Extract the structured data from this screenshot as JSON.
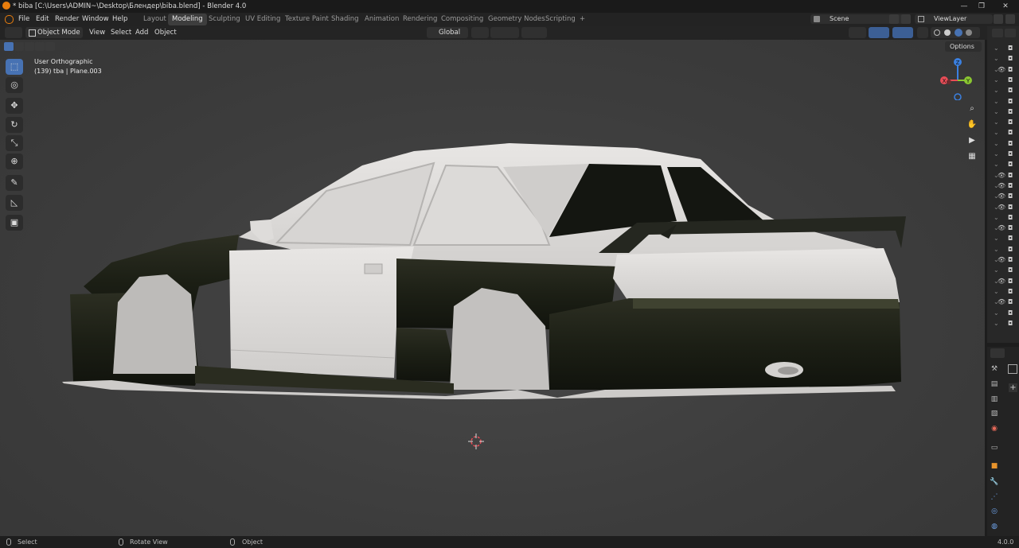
{
  "window": {
    "title": "* biba [C:\\Users\\ADMIN~\\Desktop\\Блендер\\biba.blend] - Blender 4.0",
    "controls": [
      "—",
      "❐",
      "✕"
    ]
  },
  "menu": [
    "File",
    "Edit",
    "Render",
    "Window",
    "Help"
  ],
  "workspaces": [
    "Layout",
    "Modeling",
    "Sculpting",
    "UV Editing",
    "Texture Paint",
    "Shading",
    "Animation",
    "Rendering",
    "Compositing",
    "Geometry Nodes",
    "Scripting",
    "+"
  ],
  "active_workspace": "Modeling",
  "scene": {
    "name": "Scene"
  },
  "view_layer": {
    "name": "ViewLayer"
  },
  "header": {
    "mode": "Object Mode",
    "menus": [
      "View",
      "Select",
      "Add",
      "Object"
    ],
    "orientation": "Global",
    "options": "Options"
  },
  "viewport": {
    "view_name": "User Orthographic",
    "object_info": "(139) tba | Plane.003",
    "gizmo_axes": {
      "x": "X",
      "y": "Y",
      "z": "Z"
    }
  },
  "toolbar": {
    "tools": [
      "select-box",
      "cursor",
      "move",
      "rotate",
      "scale",
      "transform",
      "annotate",
      "measure",
      "add-cube"
    ],
    "active_tool": "select-box"
  },
  "outliner": {
    "row_count": 27,
    "visible_rows": [
      false,
      false,
      true,
      false,
      false,
      false,
      false,
      false,
      false,
      false,
      false,
      false,
      true,
      true,
      true,
      true,
      false,
      true,
      false,
      false,
      true,
      false,
      true,
      false,
      true,
      false,
      false
    ]
  },
  "statusbar": {
    "left": "Select",
    "middle": "Rotate View",
    "right_action": "Object",
    "version": "4.0.0"
  },
  "colors": {
    "accent": "#4772b3",
    "viewport_bg": "#3d3d3d",
    "axis_x": "#e84d57",
    "axis_y": "#8ac631",
    "axis_z": "#3b80e0"
  }
}
